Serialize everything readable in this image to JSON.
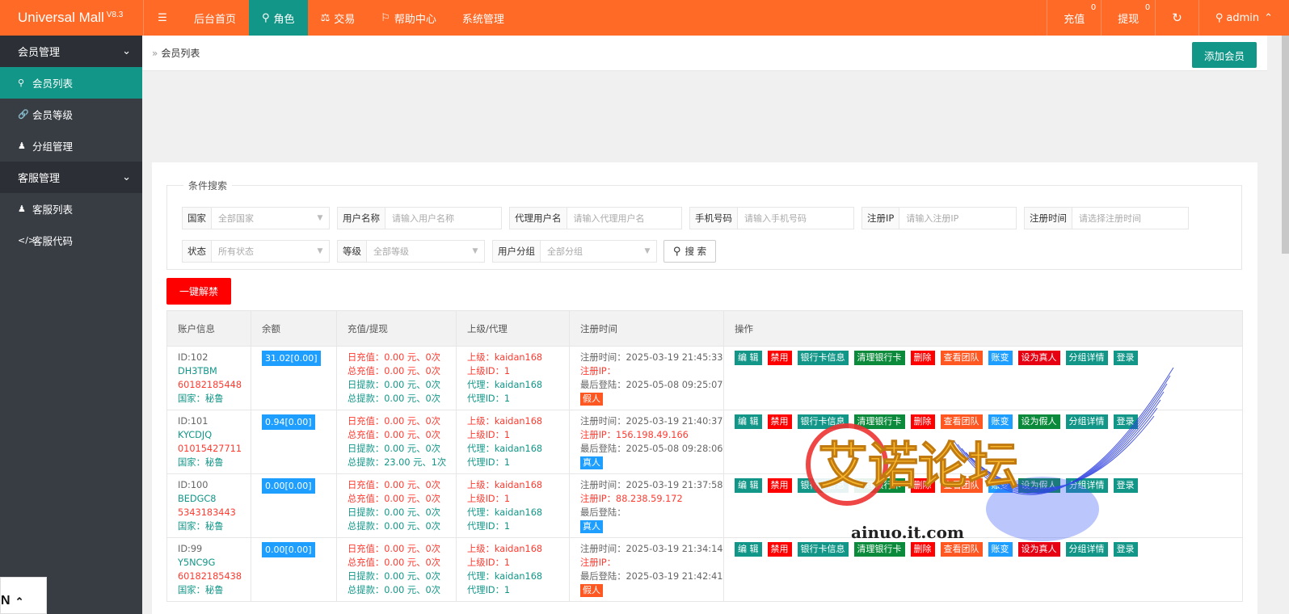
{
  "app": {
    "title": "Universal Mall",
    "version": "V8.3"
  },
  "topnav": {
    "items": [
      {
        "label": "后台首页",
        "icon": ""
      },
      {
        "label": "角色",
        "icon": "user-icon"
      },
      {
        "label": "交易",
        "icon": "scale-icon"
      },
      {
        "label": "帮助中心",
        "icon": "flag-icon"
      },
      {
        "label": "系统管理",
        "icon": ""
      }
    ],
    "recharge": {
      "label": "充值",
      "count": "0"
    },
    "withdraw": {
      "label": "提现",
      "count": "0"
    },
    "user": "admin"
  },
  "sidebar": {
    "groups": [
      {
        "label": "会员管理",
        "items": [
          {
            "label": "会员列表",
            "icon": "user-icon"
          },
          {
            "label": "会员等级",
            "icon": "link-icon"
          },
          {
            "label": "分组管理",
            "icon": "users-icon"
          }
        ]
      },
      {
        "label": "客服管理",
        "items": [
          {
            "label": "客服列表",
            "icon": "users-icon"
          },
          {
            "label": "客服代码",
            "icon": "code-icon"
          }
        ]
      }
    ]
  },
  "breadcrumb": "会员列表",
  "add_button": "添加会员",
  "search": {
    "legend": "条件搜索",
    "fields": [
      {
        "label": "国家",
        "value": "全部国家"
      },
      {
        "label": "用户名称",
        "value": "请输入用户名称"
      },
      {
        "label": "代理用户名",
        "value": "请输入代理用户名"
      },
      {
        "label": "手机号码",
        "value": "请输入手机号码"
      },
      {
        "label": "注册IP",
        "value": "请输入注册IP"
      },
      {
        "label": "注册时间",
        "value": "请选择注册时间"
      },
      {
        "label": "状态",
        "value": "所有状态"
      },
      {
        "label": "等级",
        "value": "全部等级"
      },
      {
        "label": "用户分组",
        "value": "全部分组"
      }
    ],
    "button": "搜 索"
  },
  "unban_button": "一键解禁",
  "table": {
    "headers": [
      "账户信息",
      "余额",
      "充值/提现",
      "上级/代理",
      "注册时间",
      "操作"
    ],
    "rows": [
      {
        "id": "ID:102",
        "username": "DH3TBM",
        "phone": "60182185448",
        "country": "国家：秘鲁",
        "balance": "31.02[0.00]",
        "day_recharge": "日充值：0.00 元、0次",
        "total_recharge": "总充值：0.00 元、0次",
        "day_withdraw": "日提款：0.00 元、0次",
        "total_withdraw": "总提款：0.00 元、0次",
        "parent": "上级：kaidan168",
        "parent_id": "上级ID：1",
        "agent": "代理：kaidan168",
        "agent_id": "代理ID：1",
        "reg_time": "注册时间：2025-03-19 21:45:33",
        "reg_ip": "注册IP：",
        "last_login": "最后登陆：2025-05-08 09:25:07",
        "kind": "假人",
        "kind_class": "fake",
        "toggle": "设为真人",
        "toggle_class": "b-crimson"
      },
      {
        "id": "ID:101",
        "username": "KYCDJQ",
        "phone": "01015427711",
        "country": "国家：秘鲁",
        "balance": "0.94[0.00]",
        "day_recharge": "日充值：0.00 元、0次",
        "total_recharge": "总充值：0.00 元、0次",
        "day_withdraw": "日提款：0.00 元、0次",
        "total_withdraw": "总提款：23.00 元、1次",
        "parent": "上级：kaidan168",
        "parent_id": "上级ID：1",
        "agent": "代理：kaidan168",
        "agent_id": "代理ID：1",
        "reg_time": "注册时间：2025-03-19 21:40:37",
        "reg_ip": "注册IP：156.198.49.166",
        "last_login": "最后登陆：2025-05-08 09:28:06",
        "kind": "真人",
        "kind_class": "real",
        "toggle": "设为假人",
        "toggle_class": "b-green"
      },
      {
        "id": "ID:100",
        "username": "BEDGC8",
        "phone": "5343183443",
        "country": "国家：秘鲁",
        "balance": "0.00[0.00]",
        "day_recharge": "日充值：0.00 元、0次",
        "total_recharge": "总充值：0.00 元、0次",
        "day_withdraw": "日提款：0.00 元、0次",
        "total_withdraw": "总提款：0.00 元、0次",
        "parent": "上级：kaidan168",
        "parent_id": "上级ID：1",
        "agent": "代理：kaidan168",
        "agent_id": "代理ID：1",
        "reg_time": "注册时间：2025-03-19 21:37:58",
        "reg_ip": "注册IP：88.238.59.172",
        "last_login": "最后登陆：",
        "kind": "真人",
        "kind_class": "real",
        "toggle": "设为假人",
        "toggle_class": "b-green"
      },
      {
        "id": "ID:99",
        "username": "Y5NC9G",
        "phone": "60182185438",
        "country": "国家：秘鲁",
        "balance": "0.00[0.00]",
        "day_recharge": "日充值：0.00 元、0次",
        "total_recharge": "总充值：0.00 元、0次",
        "day_withdraw": "日提款：0.00 元、0次",
        "total_withdraw": "总提款：0.00 元、0次",
        "parent": "上级：kaidan168",
        "parent_id": "上级ID：1",
        "agent": "代理：kaidan168",
        "agent_id": "代理ID：1",
        "reg_time": "注册时间：2025-03-19 21:34:14",
        "reg_ip": "注册IP：",
        "last_login": "最后登陆：2025-03-19 21:42:41",
        "kind": "假人",
        "kind_class": "fake",
        "toggle": "设为真人",
        "toggle_class": "b-crimson"
      }
    ],
    "ops": {
      "edit": "编 辑",
      "ban": "禁用",
      "bank": "银行卡信息",
      "clear_bank": "清理银行卡",
      "delete": "删除",
      "team": "查看团队",
      "account": "账变",
      "group_detail": "分组详情",
      "login": "登录"
    }
  },
  "watermark": {
    "title": "艾诺论坛",
    "site": "ainuo.it.com"
  },
  "corner_text": "N"
}
